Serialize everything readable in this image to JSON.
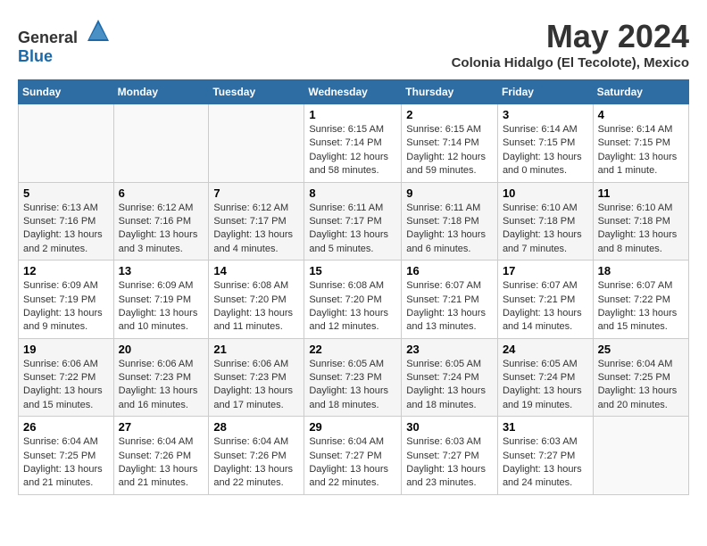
{
  "header": {
    "logo_general": "General",
    "logo_blue": "Blue",
    "month_title": "May 2024",
    "location": "Colonia Hidalgo (El Tecolote), Mexico"
  },
  "weekdays": [
    "Sunday",
    "Monday",
    "Tuesday",
    "Wednesday",
    "Thursday",
    "Friday",
    "Saturday"
  ],
  "weeks": [
    [
      {
        "day": "",
        "sunrise": "",
        "sunset": "",
        "daylight": ""
      },
      {
        "day": "",
        "sunrise": "",
        "sunset": "",
        "daylight": ""
      },
      {
        "day": "",
        "sunrise": "",
        "sunset": "",
        "daylight": ""
      },
      {
        "day": "1",
        "sunrise": "6:15 AM",
        "sunset": "7:14 PM",
        "daylight": "12 hours and 58 minutes."
      },
      {
        "day": "2",
        "sunrise": "6:15 AM",
        "sunset": "7:14 PM",
        "daylight": "12 hours and 59 minutes."
      },
      {
        "day": "3",
        "sunrise": "6:14 AM",
        "sunset": "7:15 PM",
        "daylight": "13 hours and 0 minutes."
      },
      {
        "day": "4",
        "sunrise": "6:14 AM",
        "sunset": "7:15 PM",
        "daylight": "13 hours and 1 minute."
      }
    ],
    [
      {
        "day": "5",
        "sunrise": "6:13 AM",
        "sunset": "7:16 PM",
        "daylight": "13 hours and 2 minutes."
      },
      {
        "day": "6",
        "sunrise": "6:12 AM",
        "sunset": "7:16 PM",
        "daylight": "13 hours and 3 minutes."
      },
      {
        "day": "7",
        "sunrise": "6:12 AM",
        "sunset": "7:17 PM",
        "daylight": "13 hours and 4 minutes."
      },
      {
        "day": "8",
        "sunrise": "6:11 AM",
        "sunset": "7:17 PM",
        "daylight": "13 hours and 5 minutes."
      },
      {
        "day": "9",
        "sunrise": "6:11 AM",
        "sunset": "7:18 PM",
        "daylight": "13 hours and 6 minutes."
      },
      {
        "day": "10",
        "sunrise": "6:10 AM",
        "sunset": "7:18 PM",
        "daylight": "13 hours and 7 minutes."
      },
      {
        "day": "11",
        "sunrise": "6:10 AM",
        "sunset": "7:18 PM",
        "daylight": "13 hours and 8 minutes."
      }
    ],
    [
      {
        "day": "12",
        "sunrise": "6:09 AM",
        "sunset": "7:19 PM",
        "daylight": "13 hours and 9 minutes."
      },
      {
        "day": "13",
        "sunrise": "6:09 AM",
        "sunset": "7:19 PM",
        "daylight": "13 hours and 10 minutes."
      },
      {
        "day": "14",
        "sunrise": "6:08 AM",
        "sunset": "7:20 PM",
        "daylight": "13 hours and 11 minutes."
      },
      {
        "day": "15",
        "sunrise": "6:08 AM",
        "sunset": "7:20 PM",
        "daylight": "13 hours and 12 minutes."
      },
      {
        "day": "16",
        "sunrise": "6:07 AM",
        "sunset": "7:21 PM",
        "daylight": "13 hours and 13 minutes."
      },
      {
        "day": "17",
        "sunrise": "6:07 AM",
        "sunset": "7:21 PM",
        "daylight": "13 hours and 14 minutes."
      },
      {
        "day": "18",
        "sunrise": "6:07 AM",
        "sunset": "7:22 PM",
        "daylight": "13 hours and 15 minutes."
      }
    ],
    [
      {
        "day": "19",
        "sunrise": "6:06 AM",
        "sunset": "7:22 PM",
        "daylight": "13 hours and 15 minutes."
      },
      {
        "day": "20",
        "sunrise": "6:06 AM",
        "sunset": "7:23 PM",
        "daylight": "13 hours and 16 minutes."
      },
      {
        "day": "21",
        "sunrise": "6:06 AM",
        "sunset": "7:23 PM",
        "daylight": "13 hours and 17 minutes."
      },
      {
        "day": "22",
        "sunrise": "6:05 AM",
        "sunset": "7:23 PM",
        "daylight": "13 hours and 18 minutes."
      },
      {
        "day": "23",
        "sunrise": "6:05 AM",
        "sunset": "7:24 PM",
        "daylight": "13 hours and 18 minutes."
      },
      {
        "day": "24",
        "sunrise": "6:05 AM",
        "sunset": "7:24 PM",
        "daylight": "13 hours and 19 minutes."
      },
      {
        "day": "25",
        "sunrise": "6:04 AM",
        "sunset": "7:25 PM",
        "daylight": "13 hours and 20 minutes."
      }
    ],
    [
      {
        "day": "26",
        "sunrise": "6:04 AM",
        "sunset": "7:25 PM",
        "daylight": "13 hours and 21 minutes."
      },
      {
        "day": "27",
        "sunrise": "6:04 AM",
        "sunset": "7:26 PM",
        "daylight": "13 hours and 21 minutes."
      },
      {
        "day": "28",
        "sunrise": "6:04 AM",
        "sunset": "7:26 PM",
        "daylight": "13 hours and 22 minutes."
      },
      {
        "day": "29",
        "sunrise": "6:04 AM",
        "sunset": "7:27 PM",
        "daylight": "13 hours and 22 minutes."
      },
      {
        "day": "30",
        "sunrise": "6:03 AM",
        "sunset": "7:27 PM",
        "daylight": "13 hours and 23 minutes."
      },
      {
        "day": "31",
        "sunrise": "6:03 AM",
        "sunset": "7:27 PM",
        "daylight": "13 hours and 24 minutes."
      },
      {
        "day": "",
        "sunrise": "",
        "sunset": "",
        "daylight": ""
      }
    ]
  ]
}
